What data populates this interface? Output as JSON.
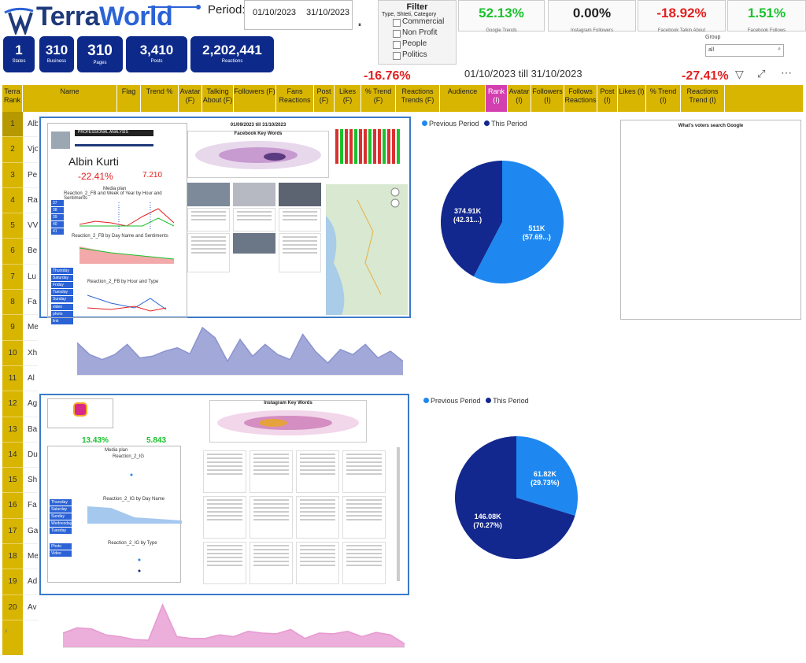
{
  "header": {
    "logo_text_1": "Terra",
    "logo_text_2": "World",
    "period_label": "Period:",
    "date_from": "01/10/2023",
    "date_to": "31/10/2023"
  },
  "stats": [
    {
      "value": "1",
      "label": "States"
    },
    {
      "value": "310",
      "label": "Business"
    },
    {
      "value": "310",
      "label": "Pages"
    },
    {
      "value": "3,410",
      "label": "Posts"
    },
    {
      "value": "2,202,441",
      "label": "Reactions"
    }
  ],
  "filter": {
    "title": "Filter",
    "subtitle": "Type, Shteti, Category",
    "items": [
      "Commercial",
      "Non Profit",
      "People",
      "Politics"
    ]
  },
  "kpis": [
    {
      "value": "52.13%",
      "label": "Google Trends",
      "color": "#19c22d"
    },
    {
      "value": "0.00%",
      "label": "Instagram Followers",
      "color": "#222222"
    },
    {
      "value": "-18.92%",
      "label": "Facebook Talkin About",
      "color": "#e32020"
    },
    {
      "value": "1.51%",
      "label": "Facebook Follows",
      "color": "#19c22d"
    }
  ],
  "group": {
    "label": "Group",
    "value": "all"
  },
  "range_text": "01/10/2023 till 31/10/2023",
  "trend_left": "-16.76%",
  "trend_right": "-27.41%",
  "table": {
    "headers": [
      "Terra Rank",
      "Name",
      "Flag",
      "Trend %",
      "Avatar (F)",
      "Talking About (F)",
      "Followers (F)",
      "Fans Reactions",
      "Post (F)",
      "Likes (F)",
      "% Trend (F)",
      "Reactions Trends (F)",
      "Audience",
      "Rank (I)",
      "Avatar (I)",
      "Followers (I)",
      "Follows Reactions",
      "Post (I)",
      "Likes (I)",
      "% Trend (I)",
      "Reactions Trend (I)"
    ],
    "ranks": [
      "1",
      "2",
      "3",
      "4",
      "5",
      "6",
      "7",
      "8",
      "9",
      "10",
      "11",
      "12",
      "13",
      "14",
      "15",
      "16",
      "17",
      "18",
      "19",
      "20"
    ],
    "names": [
      "Alb",
      "Vjo",
      "Pe",
      "Ra",
      "VV",
      "Be",
      "Lu",
      "Fa",
      "Me",
      "Xh",
      "Al",
      "Ag",
      "Ba",
      "Du",
      "Sh",
      "Fa",
      "Ga",
      "Me",
      "Ad",
      "Av"
    ]
  },
  "profile": {
    "heading": "PROFESSIONAL ANALYSIS",
    "name": "Albin Kurti",
    "trend": "-22.41%",
    "score": "7.210",
    "media_plan": "Media plan",
    "chart1": "Reaction_2_FB and Week of Year by Hour and Sentiments",
    "chart2": "Reaction_2_FB by Day Name and Sentiments",
    "chart3": "Reaction_2_FB by Hour and Type",
    "days": [
      "Thursday",
      "Saturday",
      "Friday",
      "Tuesday",
      "Sunday"
    ],
    "types": [
      "video",
      "photo",
      "link"
    ]
  },
  "facebook": {
    "range": "01/09/2023 till 31/10/2023",
    "keywords_title": "Facebook Key Words"
  },
  "pie1": {
    "legend": [
      "Previous Period",
      "This Period"
    ],
    "slices": [
      {
        "label": "511K",
        "pct": "(57.69...)",
        "value": 57.69,
        "color": "#1e88f0"
      },
      {
        "label": "374.91K",
        "pct": "(42.31...)",
        "value": 42.31,
        "color": "#13288e"
      }
    ]
  },
  "google_box_title": "What's voters search Google",
  "instagram": {
    "trend": "13.43%",
    "score": "5.843",
    "keywords_title": "Instagram Key Words",
    "media_plan": "Media plan",
    "chart1": "Reaction_2_IG",
    "chart2": "Reaction_2_IG by Day Name",
    "chart3": "Reaction_2_IG by Type",
    "days": [
      "Thursday",
      "Saturday",
      "Sunday",
      "Wednesday",
      "Tuesday"
    ],
    "types": [
      "Photo",
      "Video"
    ]
  },
  "pie2": {
    "legend": [
      "Previous Period",
      "This Period"
    ],
    "slices": [
      {
        "label": "61.82K",
        "pct": "(29.73%)",
        "value": 29.73,
        "color": "#1e88f0"
      },
      {
        "label": "146.08K",
        "pct": "(70.27%)",
        "value": 70.27,
        "color": "#13288e"
      }
    ]
  },
  "area1": {
    "color": "#8b93cf",
    "values": [
      95,
      60,
      45,
      60,
      90,
      50,
      55,
      70,
      80,
      62,
      140,
      110,
      40,
      105,
      55,
      90,
      60,
      45,
      120,
      70,
      35,
      75,
      60,
      90,
      50,
      70,
      40
    ]
  },
  "area2": {
    "color": "#e79ad1",
    "values": [
      40,
      55,
      52,
      35,
      30,
      22,
      20,
      120,
      30,
      25,
      25,
      35,
      30,
      45,
      40,
      38,
      50,
      25,
      40,
      38,
      45,
      30,
      42,
      35,
      10
    ]
  }
}
